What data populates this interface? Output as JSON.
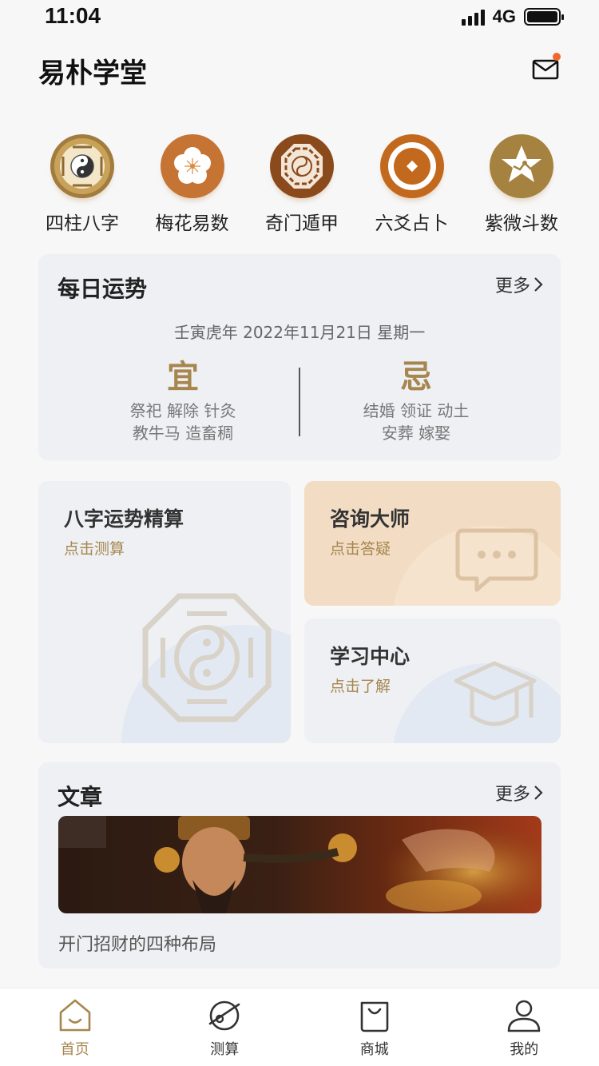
{
  "status_bar": {
    "time": "11:04",
    "network": "4G"
  },
  "header": {
    "title": "易朴学堂",
    "mail_icon": "mail-icon"
  },
  "categories": [
    {
      "label": "四柱八字",
      "icon": "bagua-icon"
    },
    {
      "label": "梅花易数",
      "icon": "plum-blossom-icon"
    },
    {
      "label": "奇门遁甲",
      "icon": "octagon-yinyang-icon"
    },
    {
      "label": "六爻占卜",
      "icon": "coin-icon"
    },
    {
      "label": "紫微斗数",
      "icon": "star-icon"
    }
  ],
  "daily_fortune": {
    "title": "每日运势",
    "more": "更多",
    "date": "壬寅虎年 2022年11月21日 星期一",
    "yi": {
      "label": "宜",
      "line1": "祭祀 解除 针灸",
      "line2": "教牛马 造畜稠"
    },
    "ji": {
      "label": "忌",
      "line1": "结婚 领证 动土",
      "line2": "安葬 嫁娶"
    }
  },
  "tiles": {
    "bazi": {
      "title": "八字运势精算",
      "sub": "点击测算"
    },
    "consult": {
      "title": "咨询大师",
      "sub": "点击答疑"
    },
    "study": {
      "title": "学习中心",
      "sub": "点击了解"
    }
  },
  "articles": {
    "title": "文章",
    "more": "更多",
    "item_title": "开门招财的四种布局"
  },
  "tabbar": [
    {
      "label": "首页",
      "icon": "home-icon",
      "active": true
    },
    {
      "label": "测算",
      "icon": "planet-icon",
      "active": false
    },
    {
      "label": "商城",
      "icon": "shopping-bag-icon",
      "active": false
    },
    {
      "label": "我的",
      "icon": "user-icon",
      "active": false
    }
  ],
  "colors": {
    "accent": "#a6864e",
    "notification": "#f06a2c",
    "card_bg": "#eef0f3",
    "consult_bg": "#f2dcc4"
  }
}
